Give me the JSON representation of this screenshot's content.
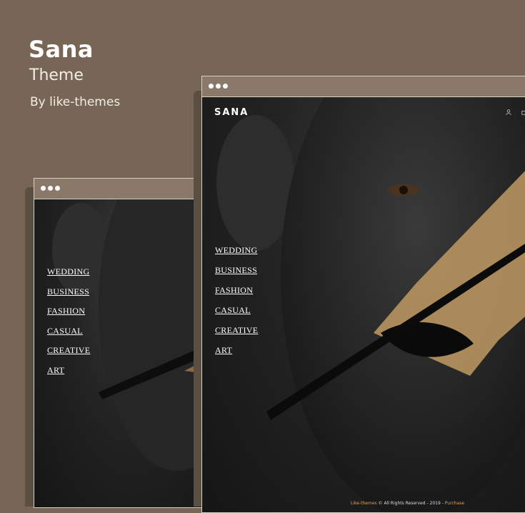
{
  "hero": {
    "title": "Sana",
    "subtitle": "Theme",
    "author": "By like-themes"
  },
  "front_preview": {
    "logo": "SANA",
    "menu": [
      "WEDDING",
      "BUSINESS",
      "FASHION",
      "CASUAL",
      "CREATIVE",
      "ART"
    ],
    "footer": {
      "brand": "Like-themes",
      "copyright": " © All Rights Reserved - 2019 - ",
      "purchase": "Purchase"
    },
    "icons": [
      "user-icon",
      "cart-icon"
    ]
  },
  "back_preview": {
    "menu": [
      "WEDDING",
      "BUSINESS",
      "FASHION",
      "CASUAL",
      "CREATIVE",
      "ART"
    ]
  },
  "colors": {
    "background": "#776655",
    "browser_bar": "#8a7868",
    "accent": "#e3a24a"
  }
}
